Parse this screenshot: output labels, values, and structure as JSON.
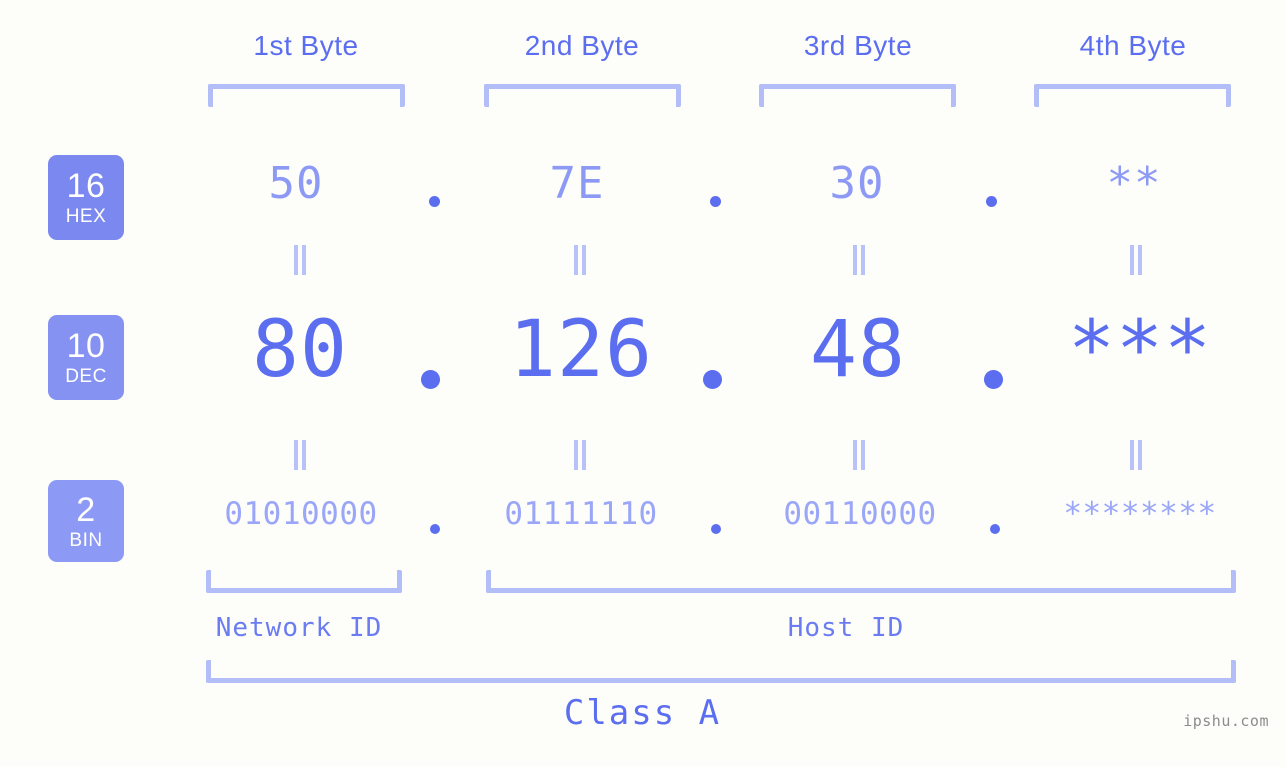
{
  "page": {
    "background_color": "#fdfdfa",
    "accent_color": "#5b6ef0",
    "light_accent_color": "#b3bdf7",
    "watermark": "ipshu.com"
  },
  "byte_headers": [
    {
      "label": "1st Byte"
    },
    {
      "label": "2nd Byte"
    },
    {
      "label": "3rd Byte"
    },
    {
      "label": "4th Byte"
    }
  ],
  "radix_badges": [
    {
      "number": "16",
      "name": "HEX",
      "color": "#7b88ef"
    },
    {
      "number": "10",
      "name": "DEC",
      "color": "#8592f2"
    },
    {
      "number": "2",
      "name": "BIN",
      "color": "#8d9af5"
    }
  ],
  "rows": {
    "hex": {
      "values": [
        "50",
        "7E",
        "30",
        "**"
      ],
      "separator": "."
    },
    "dec": {
      "values": [
        "80",
        "126",
        "48",
        "***"
      ],
      "separator": "."
    },
    "bin": {
      "values": [
        "01010000",
        "01111110",
        "00110000",
        "********"
      ],
      "separator": "."
    }
  },
  "equality_marks": {
    "glyph": "||",
    "count_per_row": 4,
    "rows": 2
  },
  "sections": [
    {
      "label": "Network ID"
    },
    {
      "label": "Host ID"
    }
  ],
  "class_label": "Class A",
  "chart_data": {
    "type": "table",
    "title": "IPv4 address byte breakdown",
    "columns": [
      "1st Byte",
      "2nd Byte",
      "3rd Byte",
      "4th Byte"
    ],
    "rows": [
      {
        "radix": "16",
        "radix_name": "HEX",
        "values": [
          "50",
          "7E",
          "30",
          "**"
        ]
      },
      {
        "radix": "10",
        "radix_name": "DEC",
        "values": [
          "80",
          "126",
          "48",
          "***"
        ]
      },
      {
        "radix": "2",
        "radix_name": "BIN",
        "values": [
          "01010000",
          "01111110",
          "00110000",
          "********"
        ]
      }
    ],
    "network_id_bytes": 1,
    "host_id_bytes": 3,
    "address_class": "Class A"
  }
}
